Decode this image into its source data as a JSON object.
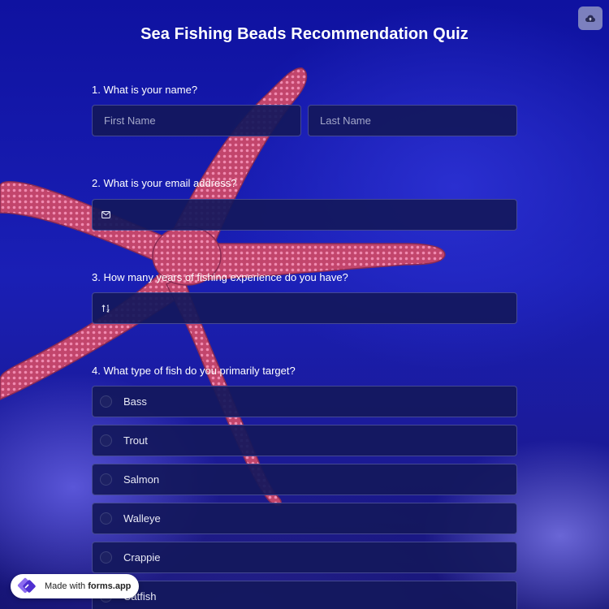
{
  "title": "Sea Fishing Beads Recommendation Quiz",
  "questions": {
    "q1": {
      "label": "1.  What is your name?",
      "first_placeholder": "First Name",
      "last_placeholder": "Last Name"
    },
    "q2": {
      "label": "2. What is your email address?",
      "icon": "envelope-icon"
    },
    "q3": {
      "label": "3. How many years of fishing experience do you have?",
      "icon": "number-sort-icon"
    },
    "q4": {
      "label": "4. What type of fish do you primarily target?",
      "options": [
        "Bass",
        "Trout",
        "Salmon",
        "Walleye",
        "Crappie",
        "Catfish"
      ]
    }
  },
  "badge": {
    "prefix": "Made with ",
    "brand": "forms.app"
  },
  "colors": {
    "background": "#1a1fb5",
    "field": "#14185c",
    "starfish": "#d9527a"
  }
}
